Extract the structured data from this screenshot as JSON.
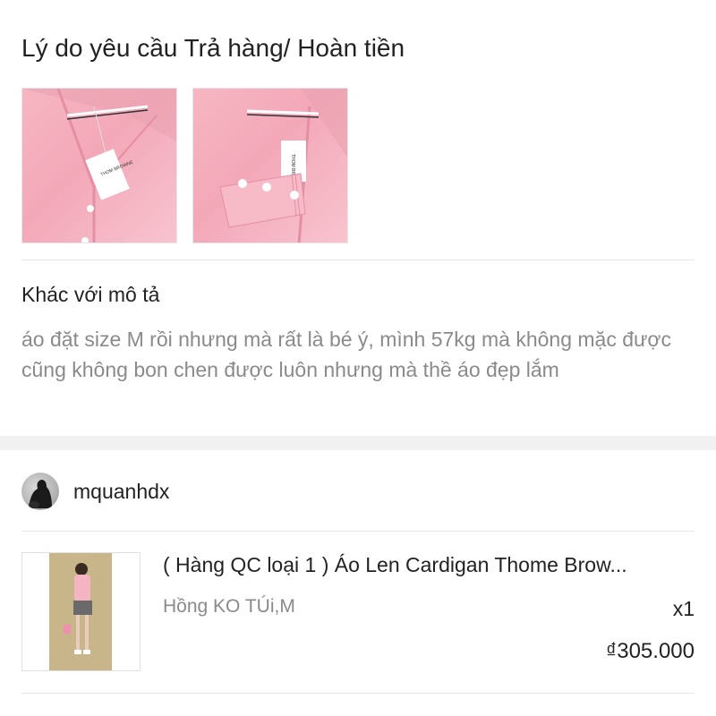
{
  "return_reason": {
    "section_title": "Lý do yêu cầu Trả hàng/ Hoàn tiền",
    "photos": [
      {
        "alt": "pink cardigan front with tag",
        "icon": "product-photo-1"
      },
      {
        "alt": "pink cardigan sleeve cuff with buttons",
        "icon": "product-photo-2"
      }
    ],
    "reason": "Khác với mô tả",
    "description": "áo đặt size M rồi nhưng mà rất là bé ý, mình 57kg mà không mặc được cũng không bon chen được luôn nhưng mà thề áo đẹp lắm"
  },
  "seller": {
    "name": "mquanhdx",
    "avatar_icon": "avatar-icon"
  },
  "product": {
    "title": "( Hàng QC loại 1 ) Áo Len Cardigan Thome Brow...",
    "variant": "Hồng KO TÚi,M",
    "quantity": "x1",
    "price": "₫305.000"
  },
  "colors": {
    "text_primary": "#222222",
    "text_secondary": "#8a8a8a",
    "divider": "#e8e8e8",
    "section_gap": "#f1f1f1",
    "cardigan_pink": "#f5aebe"
  }
}
